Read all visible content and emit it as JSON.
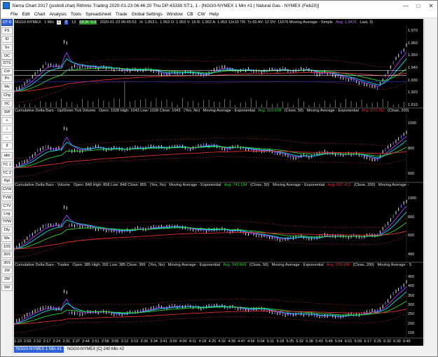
{
  "window": {
    "title": "Sierra Chart 2017 (justin8.chat)  Rithmic Trading 2020-01-23 06:46:20 Thu  DP:43339  ST:1, 1 - [NGG0-NYMEX  1 Min  #1 | Natural Gas - NYMEX (Feb20)]",
    "minimize": "—",
    "maximize": "□",
    "close": "✕"
  },
  "menu": [
    "File",
    "Edit",
    "Chart",
    "Analysis",
    "Tools",
    "Spreadsheet",
    "Trade",
    "Global Settings",
    "Window",
    "CB",
    "CW",
    "Help"
  ],
  "toolbar": [
    "DT-6",
    "FS",
    "ID",
    "Sv",
    "OC",
    "DTS",
    "Crh",
    "Pn",
    "Mv",
    "Chg",
    "SC",
    "SW",
    "+",
    "↕",
    "⇔",
    "⇕",
    "abc",
    "TC 1",
    "TC 2",
    "Rpl",
    "CVW",
    "TVW",
    "CTV",
    "Log",
    "TPW",
    "Dly",
    "We",
    "10S",
    "20S",
    "30S",
    "1M",
    "2M",
    "5M"
  ],
  "tab_labels": {
    "first": "1/23",
    "second": "justin8"
  },
  "price": {
    "header": {
      "symbol": "NGG0-NYMEX",
      "interval": "1 Min",
      "box_c": "C",
      "box_t": "T",
      "value_t": "13",
      "ocr": "OCR: 0.0",
      "datetime": "2020-01-23  06:45:53",
      "values": "H: 1.953  L: 1.953  O: 1.953  V: 16  B: 1.952  A: 1.953  12x15  TR: 7x 65  AV: 12  DV: 11676  Moving Average - Simple",
      "avg_label": "Avg: 1.9431",
      "last_label": "Last, 3)"
    },
    "axis": [
      "1.970",
      "1.960",
      "1.950",
      "1.940",
      "1.930",
      "1.920",
      "1.910"
    ]
  },
  "panels": [
    {
      "title": "Cumulative Delta Bars - Up/Down Tick Volume",
      "stats": "Open: 1028  High: 1043  Low: 1028  Close: 1043",
      "flags": "(Yes, No)",
      "ma1": "Moving Average - Exponential",
      "avg1": "Avg: 919.678",
      "p1": "(Close, 50)",
      "ma2": "Moving Average - Exponential",
      "avg2": "Avg: 873.011",
      "p2": "(Close, 200)",
      "axis": [
        "1000",
        "800",
        "600"
      ]
    },
    {
      "title": "Cumulative Delta Bars - Volume",
      "stats": "Open: 848  High: 858  Low: 848  Close: 855",
      "flags": "(Yes, No)",
      "ma1": "Moving Average - Exponential",
      "avg1": "Avg: 742.184",
      "p1": "(Close, 50)",
      "ma2": "Moving Average - Exponential",
      "avg2": "Avg: 697.413",
      "p2": "(Close, 200)",
      "ma3": "Moving Average -",
      "axis": [
        "1000",
        "800",
        "600",
        "400"
      ]
    },
    {
      "title": "Cumulative Delta Bars - Trades",
      "stats": "Open: 385  High: 392  Low: 385  Close: 389",
      "flags": "(Yes, No)",
      "ma1": "Moving Average - Exponential",
      "avg1": "Avg: 343.843",
      "p1": "(Close, 50)",
      "ma2": "Moving Average - Exponential",
      "avg2": "Avg: 330.498",
      "p2": "(Close, 200)",
      "ma3": "Moving Average - S",
      "axis": [
        "450",
        "400",
        "350",
        "300",
        "250",
        "200",
        "150"
      ]
    }
  ],
  "time_axis": [
    "1-23",
    "2:03",
    "2:10",
    "2:17",
    "2:24",
    "2:31",
    "2:37",
    "2:44",
    "2:51",
    "2:58",
    "3:05",
    "3:12",
    "3:19",
    "3:26",
    "3:34",
    "3:41",
    "3:50",
    "4:00",
    "4:11",
    "4:18",
    "4:25",
    "4:32",
    "4:39",
    "4:47",
    "4:55",
    "5:04",
    "5:11",
    "5:18",
    "5:25",
    "5:32",
    "5:38",
    "5:43",
    "5:48",
    "5:54",
    "6:01",
    "6:09",
    "6:17",
    "6:25",
    "6:32",
    "6:39",
    "6:46"
  ],
  "tabs": [
    "NGG0-NYMEX  1 Min  #1",
    "NGG0-NYMEX [C]  240 Min  #2"
  ],
  "colors": {
    "background": "#000000",
    "accent": "#2f62d6",
    "ma_fast": "#00e0e0",
    "ma_mid": "#2fd32f",
    "ma_slow": "#e03030",
    "price_line": "#ffffff"
  }
}
